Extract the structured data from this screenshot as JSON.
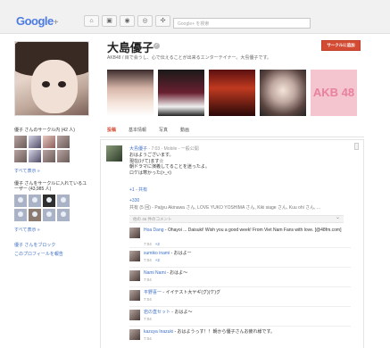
{
  "topbar": {
    "logo": "Google",
    "logo_plus": "+",
    "search_placeholder": "Google+ を検索",
    "nav_icons": [
      "home-icon",
      "photos-icon",
      "profile-icon",
      "circles-icon",
      "games-icon"
    ]
  },
  "profile": {
    "name": "大島優子",
    "subtitle": "AKB48 / 目で会うし、心で伝えることが出来るエンターテイナー。大島優子です。",
    "add_button": "サークルに追加",
    "photo_badge": "AKB 48"
  },
  "left": {
    "circles_label": "優子 さんのサークル内 (42 人)",
    "show_all_1": "すべて表示 »",
    "in_circles_label": "優子 さんをサークルに入れているユーザー (43,985 人)",
    "show_all_2": "すべて表示 »",
    "block_link": "優子 さんをブロック",
    "report_link": "このプロフィールを報告"
  },
  "tabs": [
    "投稿",
    "基本情報",
    "写真",
    "動画"
  ],
  "post": {
    "author": "大島優子",
    "meta": " - 7:03 - Mobile - 一般公開",
    "lines": [
      "おはようございます。",
      "現在(けて)ます☆",
      "朝ドラマに演義してることを迷ったよ。",
      "ロケは寒かった(>_<)"
    ],
    "plus1": "+1 - 共有",
    "shares": "+330",
    "shared_by": "共有 (5 回) - Paijyu Akinawa さん, LOVE YUKO YOSHIMA さん, Kiki siage さん, Kuu ohi さん, ...",
    "comment_bar": "他の 46 件のコメント"
  },
  "comments": [
    {
      "who": "Hoa Dang",
      "text": " - Ohayoi ... Daisuki! Wish you a good week! From Viet Nam Fans with love. [@48fm.com]",
      "time": "7:04",
      "plus": "+2"
    },
    {
      "who": "sumiko inami",
      "text": " - おはよー",
      "time": "7:04",
      "plus": "+2"
    },
    {
      "who": "Nami Nami",
      "text": " - おはよ〜",
      "time": "7:04",
      "plus": ""
    },
    {
      "who": "平野喜一",
      "text": " - イイテスト大ヤギ(グ)(ケ)グ",
      "time": "7:04",
      "plus": ""
    },
    {
      "who": "岩の直セット",
      "text": " - おはよ〜",
      "time": "7:04",
      "plus": ""
    },
    {
      "who": "kazuya Inazuki",
      "text": " - おはようっす！！朝から優子さんお疲れ様です。",
      "time": "7:04",
      "plus": ""
    }
  ]
}
